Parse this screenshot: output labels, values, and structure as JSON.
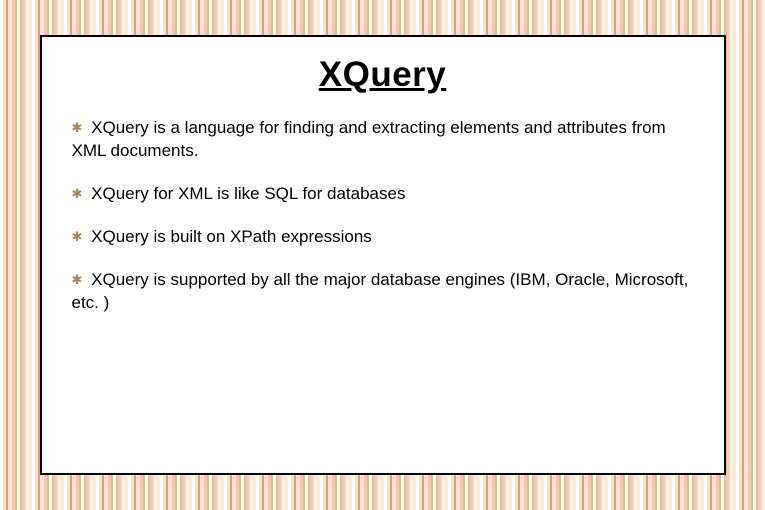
{
  "slide": {
    "title": "XQuery",
    "bullets": [
      "XQuery is a language for finding and extracting elements and attributes from XML documents.",
      "XQuery for XML is like SQL for databases",
      "XQuery is built on XPath expressions",
      "XQuery is supported by all the major database engines (IBM, Oracle, Microsoft, etc. )"
    ]
  }
}
